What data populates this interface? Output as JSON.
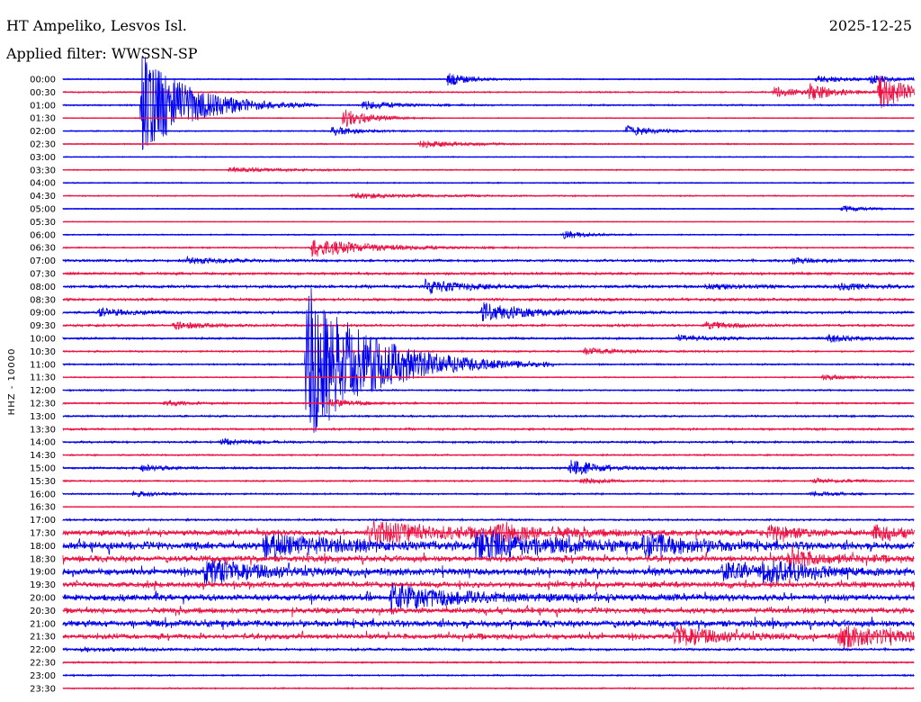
{
  "header": {
    "station": "HT Ampeliko, Lesvos Isl.",
    "date": "2025-12-25",
    "filter": "Applied filter: WWSSN-SP"
  },
  "chart_data": {
    "type": "seismogram",
    "title": "HT Ampeliko, Lesvos Isl.",
    "date": "2025-12-25",
    "filter": "WWSSN-SP",
    "ylabel": "HHZ - 10000",
    "colors": [
      "#0000ee",
      "#ee1144"
    ],
    "rows": [
      "00:00",
      "00:30",
      "01:00",
      "01:30",
      "02:00",
      "02:30",
      "03:00",
      "03:30",
      "04:00",
      "04:30",
      "05:00",
      "05:30",
      "06:00",
      "06:30",
      "07:00",
      "07:30",
      "08:00",
      "08:30",
      "09:00",
      "09:30",
      "10:00",
      "10:30",
      "11:00",
      "11:30",
      "12:00",
      "12:30",
      "13:00",
      "13:30",
      "14:00",
      "14:30",
      "15:00",
      "15:30",
      "16:00",
      "16:30",
      "17:00",
      "17:30",
      "18:00",
      "18:30",
      "19:00",
      "19:30",
      "20:00",
      "20:30",
      "21:00",
      "21:30",
      "22:00",
      "22:30",
      "23:00",
      "23:30"
    ],
    "noise_level": [
      0.6,
      0.7,
      0.8,
      0.5,
      0.6,
      0.6,
      0.5,
      0.6,
      0.6,
      0.6,
      0.5,
      0.4,
      0.6,
      0.7,
      1.2,
      1.2,
      1.4,
      1.3,
      1.2,
      1.1,
      1.0,
      0.8,
      0.8,
      0.6,
      0.8,
      0.8,
      0.9,
      1.0,
      1.0,
      0.8,
      1.0,
      0.8,
      0.8,
      0.5,
      0.9,
      2.5,
      3.5,
      2.8,
      3.0,
      2.6,
      3.0,
      2.6,
      3.0,
      2.4,
      1.2,
      0.8,
      0.7,
      0.7
    ],
    "events": [
      {
        "row": 0,
        "minute": 13.5,
        "amp": 8,
        "dur": 0.8
      },
      {
        "row": 0,
        "minute": 26.5,
        "amp": 4,
        "dur": 1.2
      },
      {
        "row": 0,
        "minute": 28.4,
        "amp": 4,
        "dur": 1.0
      },
      {
        "row": 1,
        "minute": 25.0,
        "amp": 7,
        "dur": 0.8
      },
      {
        "row": 1,
        "minute": 26.2,
        "amp": 10,
        "dur": 0.9
      },
      {
        "row": 1,
        "minute": 28.7,
        "amp": 22,
        "dur": 1.0
      },
      {
        "row": 2,
        "minute": 2.7,
        "amp": 60,
        "dur": 1.6
      },
      {
        "row": 2,
        "minute": 10.5,
        "amp": 5,
        "dur": 1.2
      },
      {
        "row": 3,
        "minute": 9.8,
        "amp": 12,
        "dur": 0.9
      },
      {
        "row": 4,
        "minute": 9.4,
        "amp": 5,
        "dur": 1.0
      },
      {
        "row": 4,
        "minute": 19.8,
        "amp": 7,
        "dur": 0.9
      },
      {
        "row": 5,
        "minute": 12.5,
        "amp": 4,
        "dur": 1.6
      },
      {
        "row": 7,
        "minute": 5.8,
        "amp": 3,
        "dur": 2.0
      },
      {
        "row": 9,
        "minute": 10.1,
        "amp": 3,
        "dur": 2.4
      },
      {
        "row": 10,
        "minute": 27.4,
        "amp": 4,
        "dur": 0.8
      },
      {
        "row": 12,
        "minute": 17.6,
        "amp": 5,
        "dur": 0.8
      },
      {
        "row": 13,
        "minute": 8.7,
        "amp": 11,
        "dur": 2.0
      },
      {
        "row": 14,
        "minute": 4.3,
        "amp": 4,
        "dur": 1.2
      },
      {
        "row": 14,
        "minute": 25.6,
        "amp": 3,
        "dur": 1.0
      },
      {
        "row": 16,
        "minute": 12.7,
        "amp": 8,
        "dur": 1.4
      },
      {
        "row": 16,
        "minute": 22.6,
        "amp": 3,
        "dur": 1.2
      },
      {
        "row": 16,
        "minute": 27.3,
        "amp": 4,
        "dur": 1.0
      },
      {
        "row": 18,
        "minute": 1.2,
        "amp": 4,
        "dur": 1.4
      },
      {
        "row": 18,
        "minute": 14.7,
        "amp": 11,
        "dur": 1.6
      },
      {
        "row": 19,
        "minute": 3.8,
        "amp": 4,
        "dur": 1.2
      },
      {
        "row": 19,
        "minute": 22.6,
        "amp": 4,
        "dur": 1.2
      },
      {
        "row": 20,
        "minute": 21.6,
        "amp": 3,
        "dur": 1.4
      },
      {
        "row": 20,
        "minute": 26.9,
        "amp": 4,
        "dur": 1.2
      },
      {
        "row": 21,
        "minute": 18.3,
        "amp": 4,
        "dur": 1.2
      },
      {
        "row": 22,
        "minute": 8.5,
        "amp": 95,
        "dur": 2.2
      },
      {
        "row": 23,
        "minute": 26.7,
        "amp": 3,
        "dur": 1.2
      },
      {
        "row": 25,
        "minute": 9.3,
        "amp": 4,
        "dur": 1.2
      },
      {
        "row": 25,
        "minute": 3.5,
        "amp": 3,
        "dur": 1.0
      },
      {
        "row": 28,
        "minute": 5.5,
        "amp": 4,
        "dur": 1.0
      },
      {
        "row": 30,
        "minute": 17.8,
        "amp": 10,
        "dur": 1.0
      },
      {
        "row": 30,
        "minute": 2.7,
        "amp": 3,
        "dur": 1.0
      },
      {
        "row": 31,
        "minute": 18.2,
        "amp": 4,
        "dur": 0.8
      },
      {
        "row": 31,
        "minute": 26.4,
        "amp": 3,
        "dur": 1.0
      },
      {
        "row": 32,
        "minute": 2.4,
        "amp": 3,
        "dur": 1.0
      },
      {
        "row": 32,
        "minute": 26.3,
        "amp": 3,
        "dur": 1.0
      },
      {
        "row": 35,
        "minute": 10.7,
        "amp": 12,
        "dur": 3.5
      },
      {
        "row": 35,
        "minute": 15.2,
        "amp": 8,
        "dur": 1.6
      },
      {
        "row": 35,
        "minute": 24.8,
        "amp": 9,
        "dur": 1.0
      },
      {
        "row": 35,
        "minute": 28.5,
        "amp": 9,
        "dur": 1.0
      },
      {
        "row": 36,
        "minute": 7.0,
        "amp": 14,
        "dur": 2.4
      },
      {
        "row": 36,
        "minute": 14.5,
        "amp": 16,
        "dur": 2.5
      },
      {
        "row": 36,
        "minute": 20.4,
        "amp": 12,
        "dur": 1.6
      },
      {
        "row": 37,
        "minute": 25.5,
        "amp": 10,
        "dur": 1.2
      },
      {
        "row": 38,
        "minute": 4.9,
        "amp": 14,
        "dur": 2.0
      },
      {
        "row": 38,
        "minute": 24.6,
        "amp": 12,
        "dur": 1.6
      },
      {
        "row": 38,
        "minute": 23.2,
        "amp": 10,
        "dur": 1.2
      },
      {
        "row": 40,
        "minute": 11.5,
        "amp": 14,
        "dur": 2.2
      },
      {
        "row": 43,
        "minute": 21.5,
        "amp": 12,
        "dur": 1.6
      },
      {
        "row": 43,
        "minute": 27.3,
        "amp": 12,
        "dur": 2.0
      },
      {
        "row": 44,
        "minute": 0.6,
        "amp": 2,
        "dur": 1.6
      }
    ]
  }
}
